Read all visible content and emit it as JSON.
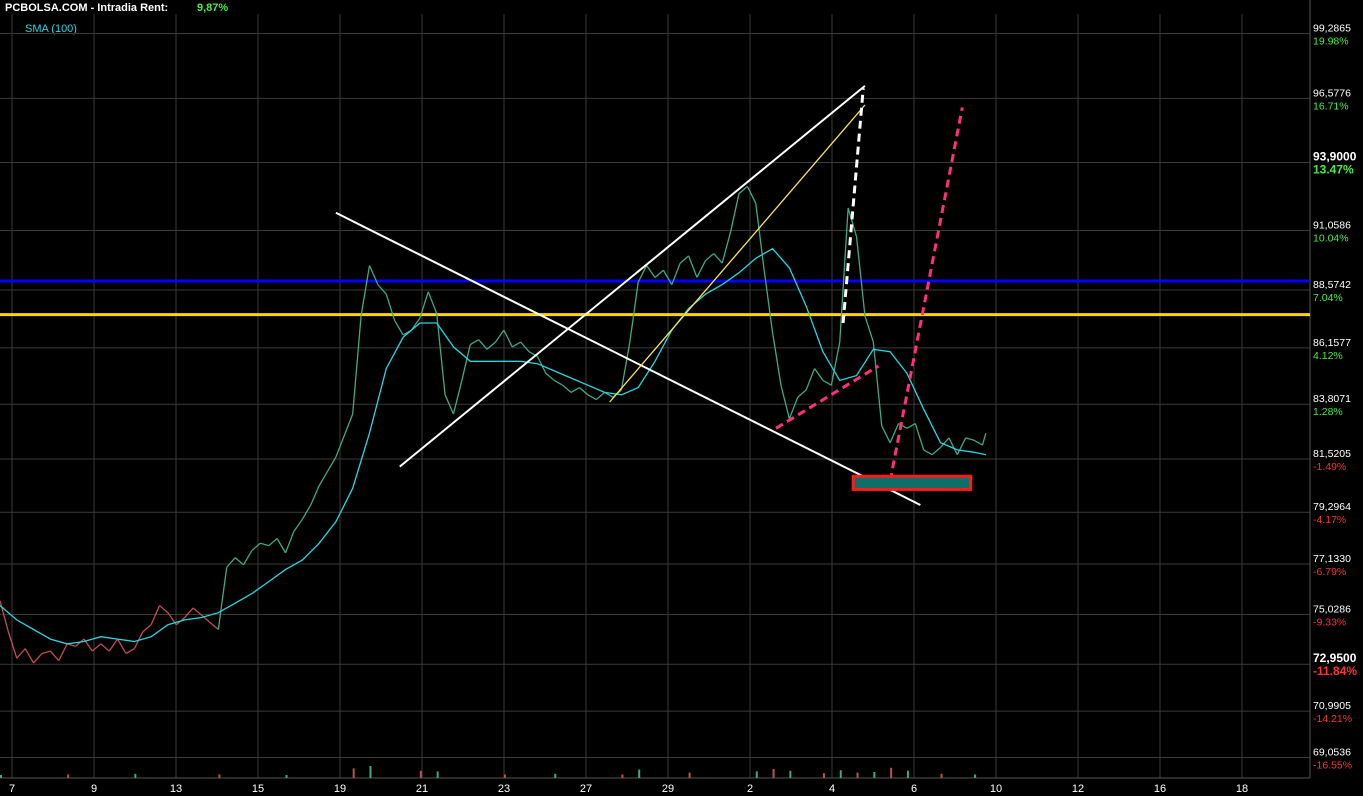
{
  "header": {
    "source": "PCBOLSA.COM",
    "separator": "-",
    "mode": "Intradia",
    "rent_label": "Rent:",
    "rent_value": "9,87%"
  },
  "indicator": {
    "label": "SMA (100)"
  },
  "colors": {
    "background": "#000000",
    "grid": "#3a3a3a",
    "price_up": "#3fa88a",
    "price_down": "#c0504d",
    "sma": "#26d7e0",
    "hline_blue": "#0000ff",
    "hline_yellow": "#ffd600",
    "trend_white": "#ffffff",
    "trend_yellow": "#ffe44d",
    "dashed_pink": "#ff2f7d",
    "box_outline": "#ff1a1a",
    "box_fill": "#0f6e68",
    "pct_positive": "#44ee44",
    "pct_negative": "#ff3333"
  },
  "chart_data": {
    "type": "line",
    "x_tick_labels": [
      "7",
      "9",
      "13",
      "15",
      "19",
      "21",
      "23",
      "27",
      "29",
      "2",
      "4",
      "6",
      "10",
      "12",
      "16",
      "18"
    ],
    "y_axis": {
      "ylim": [
        68.2,
        100.1
      ],
      "ticks": [
        {
          "price": "99,2865",
          "pct": "19.98%",
          "bold": false
        },
        {
          "price": "96,5776",
          "pct": "16.71%",
          "bold": false
        },
        {
          "price": "93,9000",
          "pct": "13.47%",
          "bold": true
        },
        {
          "price": "91,0586",
          "pct": "10.04%",
          "bold": false
        },
        {
          "price": "88,5742",
          "pct": "7.04%",
          "bold": false
        },
        {
          "price": "86,1577",
          "pct": "4.12%",
          "bold": false
        },
        {
          "price": "83,8071",
          "pct": "1.28%",
          "bold": false
        },
        {
          "price": "81,5205",
          "pct": "-1.49%",
          "bold": false
        },
        {
          "price": "79,2964",
          "pct": "-4.17%",
          "bold": false
        },
        {
          "price": "77,1330",
          "pct": "-6.79%",
          "bold": false
        },
        {
          "price": "75,0286",
          "pct": "-9.33%",
          "bold": false
        },
        {
          "price": "72,9500",
          "pct": "-11.84%",
          "bold": true
        },
        {
          "price": "70,9905",
          "pct": "-14.21%",
          "bold": false
        },
        {
          "price": "69,0536",
          "pct": "-16.55%",
          "bold": false
        }
      ]
    },
    "series": [
      {
        "role": "price",
        "points": [
          [
            0,
            75.6
          ],
          [
            0.5,
            74.3
          ],
          [
            1,
            73.2
          ],
          [
            1.5,
            73.6
          ],
          [
            2,
            73.0
          ],
          [
            2.5,
            73.4
          ],
          [
            3,
            73.5
          ],
          [
            3.5,
            73.1
          ],
          [
            4,
            73.8
          ],
          [
            4.5,
            73.7
          ],
          [
            5,
            74.0
          ],
          [
            5.5,
            73.5
          ],
          [
            6,
            73.8
          ],
          [
            6.5,
            73.5
          ],
          [
            7,
            74.0
          ],
          [
            7.5,
            73.4
          ],
          [
            8,
            73.6
          ],
          [
            8.5,
            74.3
          ],
          [
            9,
            74.6
          ],
          [
            9.5,
            75.4
          ],
          [
            10,
            75.1
          ],
          [
            10.5,
            74.6
          ],
          [
            11,
            74.9
          ],
          [
            11.5,
            75.3
          ],
          [
            12,
            75.0
          ],
          [
            12.5,
            74.7
          ],
          [
            13,
            74.4
          ],
          [
            13.5,
            77.0
          ],
          [
            14,
            77.4
          ],
          [
            14.5,
            77.1
          ],
          [
            15,
            77.7
          ],
          [
            15.5,
            78.0
          ],
          [
            16,
            77.9
          ],
          [
            16.5,
            78.2
          ],
          [
            17,
            77.6
          ],
          [
            17.5,
            78.5
          ],
          [
            18,
            79.0
          ],
          [
            18.5,
            79.6
          ],
          [
            19,
            80.4
          ],
          [
            19.5,
            81.0
          ],
          [
            20,
            81.6
          ],
          [
            20.5,
            82.5
          ],
          [
            21,
            83.4
          ],
          [
            21.5,
            87.5
          ],
          [
            22,
            89.6
          ],
          [
            22.5,
            88.8
          ],
          [
            23,
            88.4
          ],
          [
            23.5,
            87.3
          ],
          [
            24,
            86.7
          ],
          [
            24.5,
            86.9
          ],
          [
            25,
            87.4
          ],
          [
            25.5,
            88.5
          ],
          [
            26,
            87.6
          ],
          [
            26.5,
            84.2
          ],
          [
            27,
            83.4
          ],
          [
            27.5,
            84.8
          ],
          [
            28,
            86.3
          ],
          [
            28.5,
            86.5
          ],
          [
            29,
            86.1
          ],
          [
            29.5,
            86.4
          ],
          [
            30,
            86.9
          ],
          [
            30.5,
            86.2
          ],
          [
            31,
            86.4
          ],
          [
            31.5,
            86.0
          ],
          [
            32,
            85.8
          ],
          [
            32.5,
            85.1
          ],
          [
            33,
            84.8
          ],
          [
            33.5,
            84.6
          ],
          [
            34,
            84.3
          ],
          [
            34.5,
            84.5
          ],
          [
            35,
            84.2
          ],
          [
            35.5,
            84.0
          ],
          [
            36,
            84.3
          ],
          [
            36.5,
            84.1
          ],
          [
            37,
            84.4
          ],
          [
            37.5,
            86.4
          ],
          [
            38,
            88.9
          ],
          [
            38.5,
            89.6
          ],
          [
            39,
            89.1
          ],
          [
            39.5,
            89.4
          ],
          [
            40,
            88.8
          ],
          [
            40.5,
            89.7
          ],
          [
            41,
            90.0
          ],
          [
            41.5,
            89.1
          ],
          [
            42,
            89.8
          ],
          [
            42.5,
            90.1
          ],
          [
            43,
            89.7
          ],
          [
            43.5,
            91.0
          ],
          [
            44,
            92.6
          ],
          [
            44.5,
            92.9
          ],
          [
            45,
            92.2
          ],
          [
            45.5,
            89.4
          ],
          [
            46,
            86.8
          ],
          [
            46.5,
            84.6
          ],
          [
            47,
            83.2
          ],
          [
            47.5,
            84.1
          ],
          [
            48,
            84.4
          ],
          [
            48.5,
            85.3
          ],
          [
            49,
            84.8
          ],
          [
            49.5,
            84.6
          ],
          [
            50,
            86.4
          ],
          [
            50.5,
            92.0
          ],
          [
            51,
            90.8
          ],
          [
            51.5,
            87.5
          ],
          [
            52,
            86.4
          ],
          [
            52.5,
            82.9
          ],
          [
            53,
            82.2
          ],
          [
            53.5,
            83.0
          ],
          [
            54,
            82.8
          ],
          [
            54.5,
            83.0
          ],
          [
            55,
            81.9
          ],
          [
            55.5,
            81.7
          ],
          [
            56,
            82.0
          ],
          [
            56.5,
            82.4
          ],
          [
            57,
            81.7
          ],
          [
            57.5,
            82.4
          ],
          [
            58,
            82.3
          ],
          [
            58.5,
            82.1
          ],
          [
            58.7,
            82.6
          ]
        ]
      },
      {
        "name": "SMA (100)",
        "role": "sma",
        "points": [
          [
            0,
            75.4
          ],
          [
            1,
            74.8
          ],
          [
            2,
            74.4
          ],
          [
            3,
            74.0
          ],
          [
            4,
            73.8
          ],
          [
            5,
            73.9
          ],
          [
            6,
            74.1
          ],
          [
            7,
            74.0
          ],
          [
            8,
            73.9
          ],
          [
            9,
            74.1
          ],
          [
            10,
            74.6
          ],
          [
            11,
            74.8
          ],
          [
            12,
            74.9
          ],
          [
            13,
            75.1
          ],
          [
            14,
            75.5
          ],
          [
            15,
            75.9
          ],
          [
            16,
            76.4
          ],
          [
            17,
            76.9
          ],
          [
            18,
            77.3
          ],
          [
            19,
            78.0
          ],
          [
            20,
            78.9
          ],
          [
            21,
            80.3
          ],
          [
            22,
            82.6
          ],
          [
            23,
            85.3
          ],
          [
            24,
            86.6
          ],
          [
            25,
            87.2
          ],
          [
            26,
            87.2
          ],
          [
            27,
            86.2
          ],
          [
            28,
            85.6
          ],
          [
            29,
            85.6
          ],
          [
            30,
            85.6
          ],
          [
            31,
            85.6
          ],
          [
            32,
            85.5
          ],
          [
            33,
            85.2
          ],
          [
            34,
            84.9
          ],
          [
            35,
            84.6
          ],
          [
            36,
            84.3
          ],
          [
            37,
            84.2
          ],
          [
            38,
            84.5
          ],
          [
            39,
            85.6
          ],
          [
            40,
            86.9
          ],
          [
            41,
            87.8
          ],
          [
            42,
            88.4
          ],
          [
            43,
            88.8
          ],
          [
            44,
            89.3
          ],
          [
            45,
            89.9
          ],
          [
            46,
            90.3
          ],
          [
            47,
            89.5
          ],
          [
            48,
            87.9
          ],
          [
            49,
            86.0
          ],
          [
            50,
            84.8
          ],
          [
            51,
            85.0
          ],
          [
            52,
            86.1
          ],
          [
            53,
            86.0
          ],
          [
            54,
            85.1
          ],
          [
            55,
            83.6
          ],
          [
            56,
            82.2
          ],
          [
            57,
            81.9
          ],
          [
            58,
            81.8
          ],
          [
            58.7,
            81.7
          ]
        ]
      }
    ],
    "volume": [
      [
        0,
        0.25
      ],
      [
        4,
        0.3
      ],
      [
        8,
        0.35
      ],
      [
        13,
        0.3
      ],
      [
        17,
        0.25
      ],
      [
        21,
        0.8
      ],
      [
        22,
        1.0
      ],
      [
        25,
        0.6
      ],
      [
        26,
        0.55
      ],
      [
        30,
        0.3
      ],
      [
        33,
        0.35
      ],
      [
        37,
        0.3
      ],
      [
        38,
        0.7
      ],
      [
        41,
        0.45
      ],
      [
        45,
        0.55
      ],
      [
        46,
        0.75
      ],
      [
        47,
        0.6
      ],
      [
        49,
        0.4
      ],
      [
        50,
        0.65
      ],
      [
        51,
        0.45
      ],
      [
        52,
        0.5
      ],
      [
        53,
        0.85
      ],
      [
        54,
        0.6
      ],
      [
        56,
        0.35
      ],
      [
        58,
        0.3
      ]
    ],
    "horizontal_lines": [
      {
        "role": "hline_blue",
        "price": 88.95
      },
      {
        "role": "hline_yellow",
        "price": 87.55
      }
    ],
    "drawn_lines": [
      {
        "role": "trend_white",
        "dashed": false,
        "p1": [
          20,
          91.8
        ],
        "p2": [
          54.8,
          79.6
        ]
      },
      {
        "role": "trend_white",
        "dashed": false,
        "p1": [
          23.8,
          81.2
        ],
        "p2": [
          51.5,
          97.1
        ]
      },
      {
        "role": "trend_yellow",
        "dashed": false,
        "p1": [
          36.3,
          83.9
        ],
        "p2": [
          51.5,
          96.3
        ]
      },
      {
        "role": "trend_white",
        "dashed": true,
        "p1": [
          50.2,
          87.2
        ],
        "p2": [
          51.4,
          97.0
        ]
      },
      {
        "role": "dashed_pink",
        "dashed": true,
        "p1": [
          46.2,
          82.8
        ],
        "p2": [
          52.3,
          85.4
        ]
      },
      {
        "role": "dashed_pink",
        "dashed": true,
        "p1": [
          53.0,
          80.6
        ],
        "p2": [
          57.3,
          96.2
        ]
      }
    ],
    "support_box": {
      "x0": 50.8,
      "x1": 57.8,
      "p_top": 80.8,
      "p_bottom": 80.25
    },
    "grid": true,
    "legend": "top-left"
  }
}
